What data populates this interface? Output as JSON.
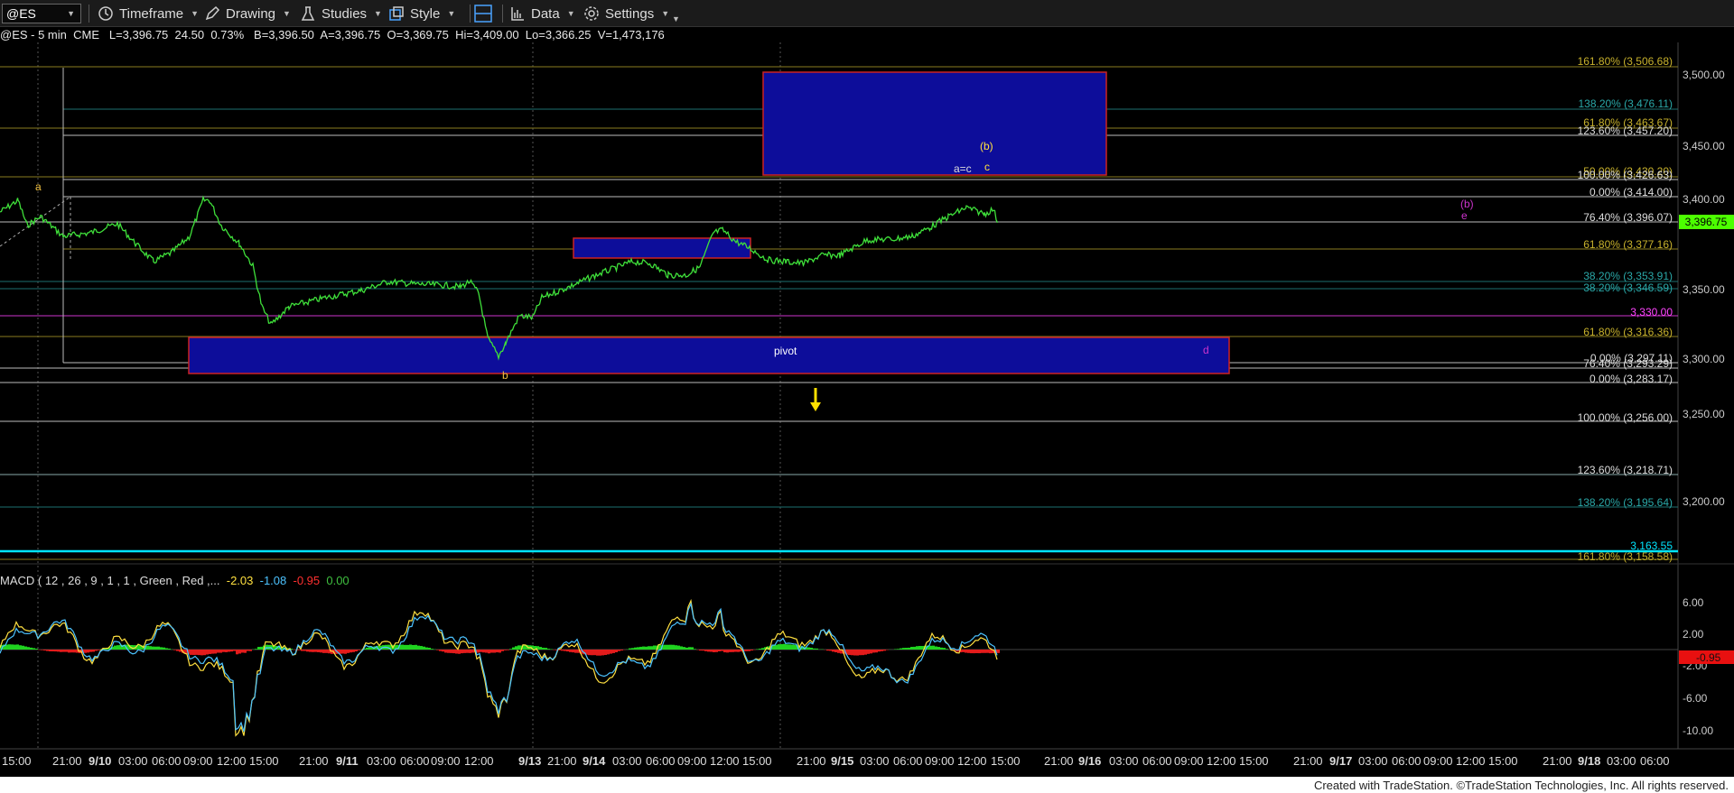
{
  "toolbar": {
    "symbol": "@ES",
    "timeframe": "Timeframe",
    "drawing": "Drawing",
    "studies": "Studies",
    "style": "Style",
    "data": "Data",
    "settings": "Settings"
  },
  "infobar": {
    "symbol": "@ES - 5 min",
    "exchange": "CME",
    "last": "L=3,396.75",
    "change": "24.50",
    "pct": "0.73%",
    "bid": "B=3,396.50",
    "ask": "A=3,396.75",
    "open": "O=3,369.75",
    "high": "Hi=3,409.00",
    "low": "Lo=3,366.25",
    "volume": "V=1,473,176"
  },
  "price_axis": {
    "ticks": [
      "3,500.00",
      "3,450.00",
      "3,400.00",
      "3,350.00",
      "3,300.00",
      "3,250.00",
      "3,200.00"
    ],
    "last_price": "3,396.75",
    "last_price_color": "#4cff00"
  },
  "fib_levels": [
    {
      "text": "161.80% (3,506.68)",
      "color": "#c8b22c"
    },
    {
      "text": "138.20% (3,476.11)",
      "color": "#2aa8a8"
    },
    {
      "text": "61.80% (3,463.67)",
      "color": "#c8b22c"
    },
    {
      "text": "123.60% (3,457.20)",
      "color": "#dddddd"
    },
    {
      "text": "50.00% (3,430.20)",
      "color": "#c8b22c"
    },
    {
      "text": "100.00% (3,426.63)",
      "color": "#dddddd"
    },
    {
      "text": "0.00% (3,414.00)",
      "color": "#dddddd"
    },
    {
      "text": "76.40% (3,396.07)",
      "color": "#dddddd"
    },
    {
      "text": "61.80% (3,377.16)",
      "color": "#c8b22c"
    },
    {
      "text": "38.20% (3,353.91)",
      "color": "#2aa8a8"
    },
    {
      "text": "38.20% (3,346.59)",
      "color": "#2aa8a8"
    },
    {
      "text": "3,330.00",
      "color": "#ff44ff"
    },
    {
      "text": "61.80% (3,316.36)",
      "color": "#c8b22c"
    },
    {
      "text": "0.00% (3,297.11)",
      "color": "#dddddd"
    },
    {
      "text": "76.40% (3,293.29)",
      "color": "#dddddd"
    },
    {
      "text": "0.00% (3,283.17)",
      "color": "#dddddd"
    },
    {
      "text": "100.00% (3,256.00)",
      "color": "#dddddd"
    },
    {
      "text": "123.60% (3,218.71)",
      "color": "#dddddd"
    },
    {
      "text": "138.20% (3,195.64)",
      "color": "#2aa8a8"
    },
    {
      "text": "3,163.55",
      "color": "#00e5ff"
    },
    {
      "text": "161.80% (3,158.58)",
      "color": "#c8b22c"
    }
  ],
  "annotations": {
    "a": "a",
    "b": "b",
    "pivot": "pivot",
    "b_paren": "(b)",
    "a_eq_c": "a=c",
    "c": "c",
    "d": "d",
    "b_paren2": "(b)",
    "e": "e"
  },
  "macd": {
    "name": "MACD ( 12 , 26 , 9 , 1 , 1 , Green , Red ,...",
    "v1": "-2.03",
    "v2": "-1.08",
    "v3": "-0.95",
    "v4": "0.00",
    "v1_color": "#ffe040",
    "v2_color": "#4cc3ff",
    "v3_color": "#ff3030",
    "v4_color": "#3fbf3f",
    "ticks": [
      "6.00",
      "2.00",
      "-2.00",
      "-6.00",
      "-10.00"
    ],
    "last": "-0.95"
  },
  "time_axis": [
    "15:00",
    "21:00",
    "9/10",
    "03:00",
    "06:00",
    "09:00",
    "12:00",
    "15:00",
    "21:00",
    "9/11",
    "03:00",
    "06:00",
    "09:00",
    "12:00",
    "9/13",
    "21:00",
    "9/14",
    "03:00",
    "06:00",
    "09:00",
    "12:00",
    "15:00",
    "21:00",
    "9/15",
    "03:00",
    "06:00",
    "09:00",
    "12:00",
    "15:00",
    "21:00",
    "9/16",
    "03:00",
    "06:00",
    "09:00",
    "12:00",
    "15:00",
    "21:00",
    "9/17",
    "03:00",
    "06:00",
    "09:00",
    "12:00",
    "15:00",
    "21:00",
    "9/18",
    "03:00",
    "06:00"
  ],
  "footer": "Created with TradeStation. ©TradeStation Technologies, Inc. All rights reserved."
}
